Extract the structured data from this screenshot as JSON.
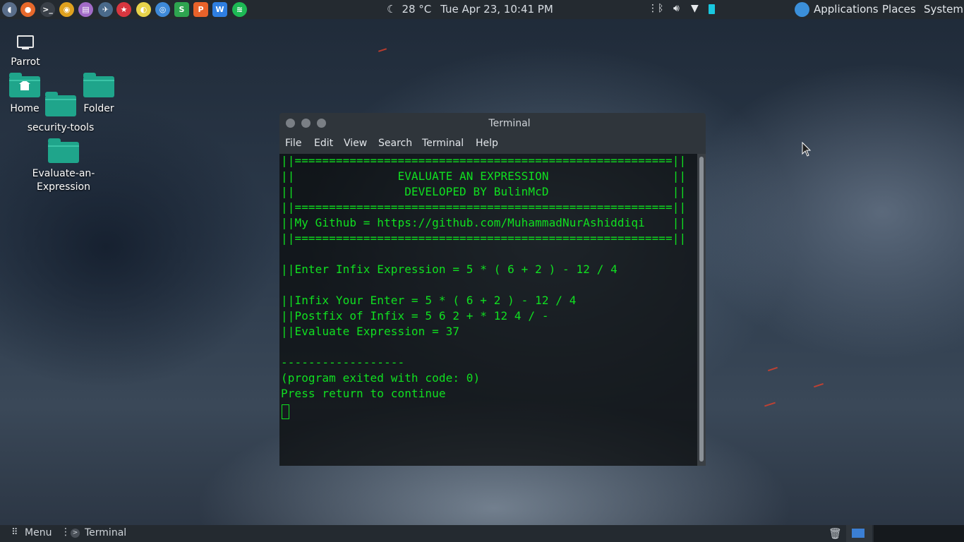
{
  "top_panel": {
    "launchers": [
      {
        "name": "parrot-menu-icon",
        "color": "#5a6e8a",
        "glyph": "◖"
      },
      {
        "name": "firefox-icon",
        "color": "#e8692b",
        "glyph": "●"
      },
      {
        "name": "terminal-launcher-icon",
        "color": "#3a4048",
        "glyph": ">_"
      },
      {
        "name": "chrome-icon",
        "color": "#e0a21f",
        "glyph": "◉"
      },
      {
        "name": "text-editor-icon",
        "color": "#a26bc7",
        "glyph": "▤"
      },
      {
        "name": "network-tool-icon",
        "color": "#4a6a8a",
        "glyph": "✈"
      },
      {
        "name": "star-app-icon",
        "color": "#d9363f",
        "glyph": "★"
      },
      {
        "name": "media-app-icon",
        "color": "#e8d34a",
        "glyph": "◐"
      },
      {
        "name": "camera-app-icon",
        "color": "#3e89d8",
        "glyph": "◎"
      },
      {
        "name": "wps-spreadsheet-icon",
        "color": "#2ea44f",
        "glyph": "S"
      },
      {
        "name": "wps-presentation-icon",
        "color": "#e8622a",
        "glyph": "P"
      },
      {
        "name": "wps-writer-icon",
        "color": "#2f7ee0",
        "glyph": "W"
      },
      {
        "name": "spotify-icon",
        "color": "#1db954",
        "glyph": "≋"
      }
    ],
    "weather": "28 °C",
    "datetime": "Tue Apr 23, 10:41 PM",
    "menus": {
      "applications": "Applications",
      "places": "Places",
      "system": "System"
    }
  },
  "desktop": {
    "items": [
      {
        "label": "Parrot"
      },
      {
        "label": "Home"
      },
      {
        "label": "Folder"
      },
      {
        "label": "security-tools"
      },
      {
        "label": "Evaluate-an-\nExpression"
      }
    ]
  },
  "terminal": {
    "title": "Terminal",
    "menu": [
      "File",
      "Edit",
      "View",
      "Search",
      "Terminal",
      "Help"
    ],
    "lines": [
      "||=======================================================||",
      "||               EVALUATE AN EXPRESSION                  ||",
      "||                DEVELOPED BY BulinMcD                  ||",
      "||=======================================================||",
      "||My Github = https://github.com/MuhammadNurAshiddiqi    ||",
      "||=======================================================||",
      "",
      "||Enter Infix Expression = 5 * ( 6 + 2 ) - 12 / 4",
      "",
      "||Infix Your Enter = 5 * ( 6 + 2 ) - 12 / 4",
      "||Postfix of Infix = 5 6 2 + * 12 4 / -",
      "||Evaluate Expression = 37",
      "",
      "------------------",
      "(program exited with code: 0)",
      "Press return to continue"
    ],
    "text_color": "#10e020"
  },
  "bottom_panel": {
    "menu_label": "Menu",
    "task_label": "Terminal"
  }
}
